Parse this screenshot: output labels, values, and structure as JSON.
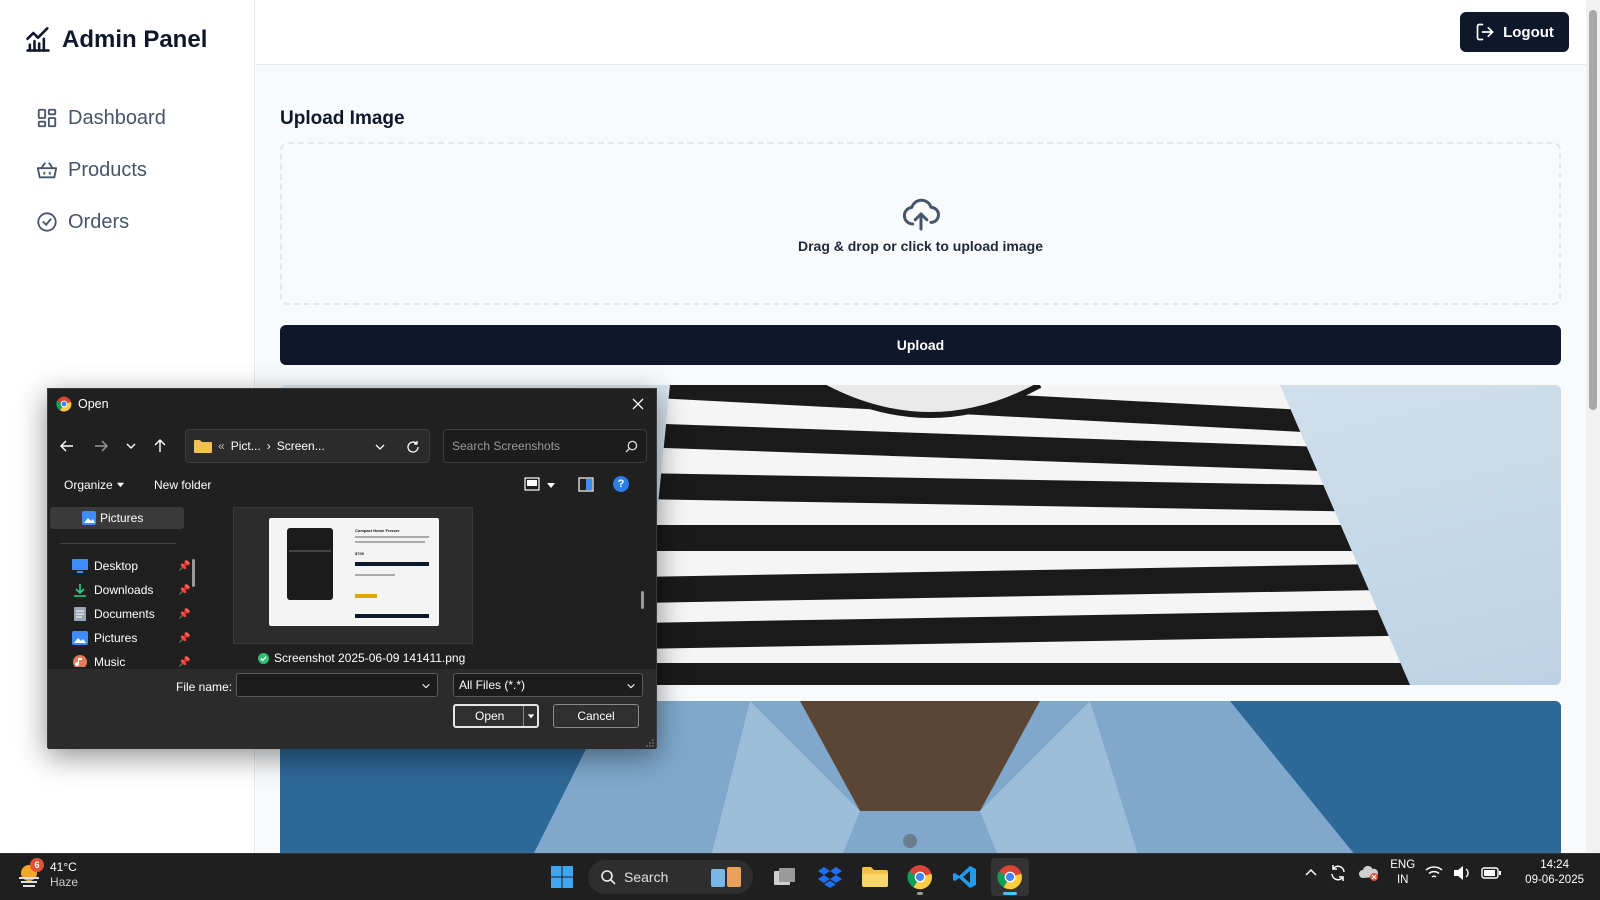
{
  "app": {
    "brand": "Admin Panel",
    "nav": [
      {
        "label": "Dashboard",
        "icon": "dashboard-grid-icon"
      },
      {
        "label": "Products",
        "icon": "basket-icon"
      },
      {
        "label": "Orders",
        "icon": "check-circle-icon"
      }
    ],
    "logout_label": "Logout",
    "upload_title": "Upload Image",
    "dropzone_text": "Drag & drop or click to upload image",
    "upload_button": "Upload"
  },
  "dialog": {
    "title": "Open",
    "address": {
      "sep": "«",
      "crumb1": "Pict...",
      "arrow": "›",
      "crumb2": "Screen..."
    },
    "search_placeholder": "Search Screenshots",
    "organize_label": "Organize",
    "new_folder_label": "New folder",
    "help_label": "?",
    "pane_top": "Pictures",
    "pane_items": [
      {
        "label": "Desktop",
        "icon": "desktop-icon"
      },
      {
        "label": "Downloads",
        "icon": "download-icon"
      },
      {
        "label": "Documents",
        "icon": "documents-icon"
      },
      {
        "label": "Pictures",
        "icon": "pictures-icon"
      },
      {
        "label": "Music",
        "icon": "music-icon"
      }
    ],
    "file": {
      "name": "Screenshot 2025-06-09 141411.png",
      "thumb_heading": "Compact Home Freezer",
      "thumb_price": "$700"
    },
    "filename_label": "File name:",
    "filename_value": "",
    "filetype_value": "All Files (*.*)",
    "open_label": "Open",
    "cancel_label": "Cancel"
  },
  "taskbar": {
    "weather_temp": "41°C",
    "weather_desc": "Haze",
    "weather_badge": "6",
    "search_label": "Search",
    "lang_line1": "ENG",
    "lang_line2": "IN",
    "time": "14:24",
    "date": "09-06-2025"
  },
  "colors": {
    "primary": "#0f172a",
    "taskbar": "#1f1f1f",
    "dialog_bg": "#202020"
  }
}
